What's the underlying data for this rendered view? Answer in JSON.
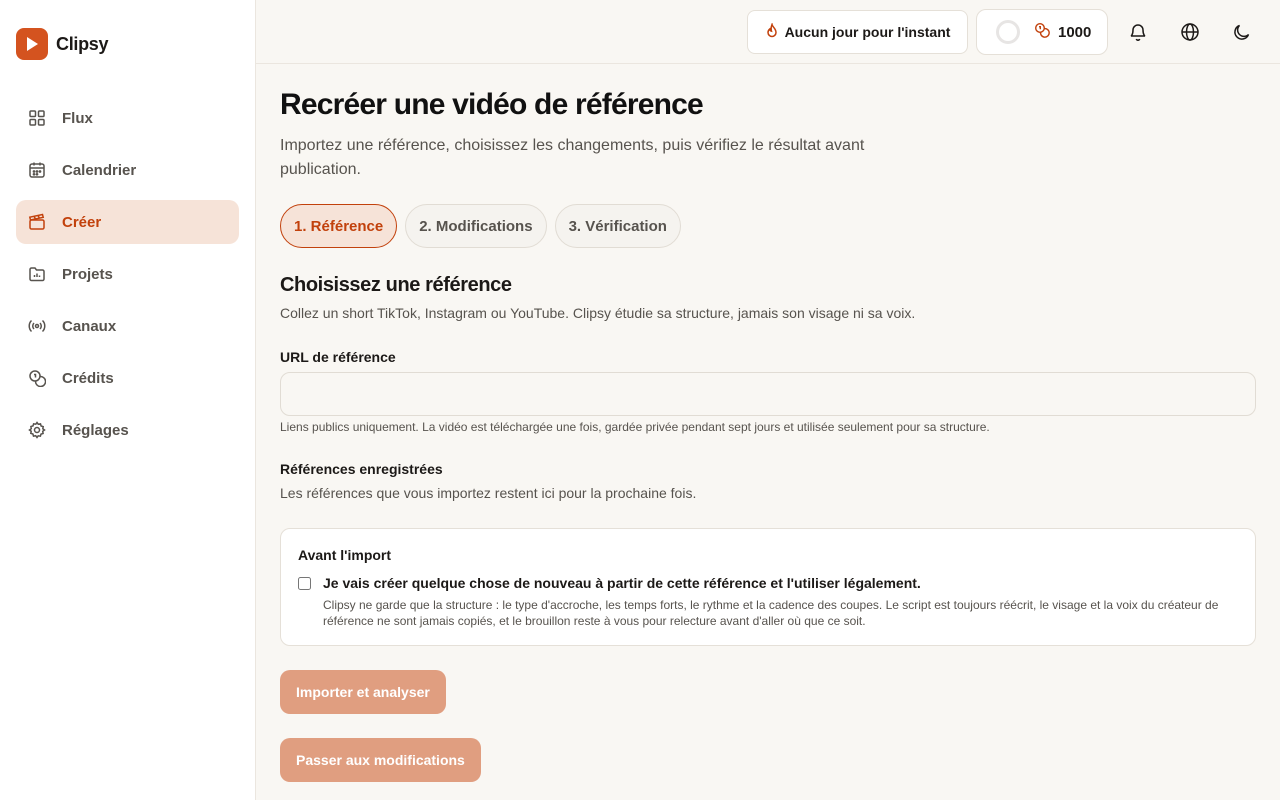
{
  "brand": {
    "name": "Clipsy",
    "accent": "#d4531f"
  },
  "sidebar": {
    "items": [
      {
        "label": "Flux",
        "icon": "grid-icon",
        "active": false
      },
      {
        "label": "Calendrier",
        "icon": "calendar-icon",
        "active": false
      },
      {
        "label": "Créer",
        "icon": "clapperboard-icon",
        "active": true
      },
      {
        "label": "Projets",
        "icon": "folder-chart-icon",
        "active": false
      },
      {
        "label": "Canaux",
        "icon": "broadcast-icon",
        "active": false
      },
      {
        "label": "Crédits",
        "icon": "coins-icon",
        "active": false
      },
      {
        "label": "Réglages",
        "icon": "gear-icon",
        "active": false
      }
    ]
  },
  "header": {
    "streak_label": "Aucun jour pour l'instant",
    "credits_value": "1000"
  },
  "main": {
    "title": "Recréer une vidéo de référence",
    "subtitle": "Importez une référence, choisissez les changements, puis vérifiez le résultat avant publication.",
    "steps": [
      {
        "label": "1.  Référence",
        "active": true
      },
      {
        "label": "2.  Modifications",
        "active": false
      },
      {
        "label": "3.  Vérification",
        "active": false
      }
    ],
    "section_title": "Choisissez une référence",
    "section_sub": "Collez un short TikTok, Instagram ou YouTube. Clipsy étudie sa structure, jamais son visage ni sa voix.",
    "url_label": "URL de référence",
    "url_value": "",
    "url_help": "Liens publics uniquement. La vidéo est téléchargée une fois, gardée privée pendant sept jours et utilisée seulement pour sa structure.",
    "saved_title": "Références enregistrées",
    "saved_sub": "Les références que vous importez restent ici pour la prochaine fois.",
    "card": {
      "title": "Avant l'import",
      "checkbox_label": "Je vais créer quelque chose de nouveau à partir de cette référence et l'utiliser légalement.",
      "checked": false,
      "description": "Clipsy ne garde que la structure : le type d'accroche, les temps forts, le rythme et la cadence des coupes. Le script est toujours réécrit, le visage et la voix du créateur de référence ne sont jamais copiés, et le brouillon reste à vous pour relecture avant d'aller où que ce soit."
    },
    "import_button": "Importer et analyser",
    "next_button": "Passer aux modifications"
  }
}
